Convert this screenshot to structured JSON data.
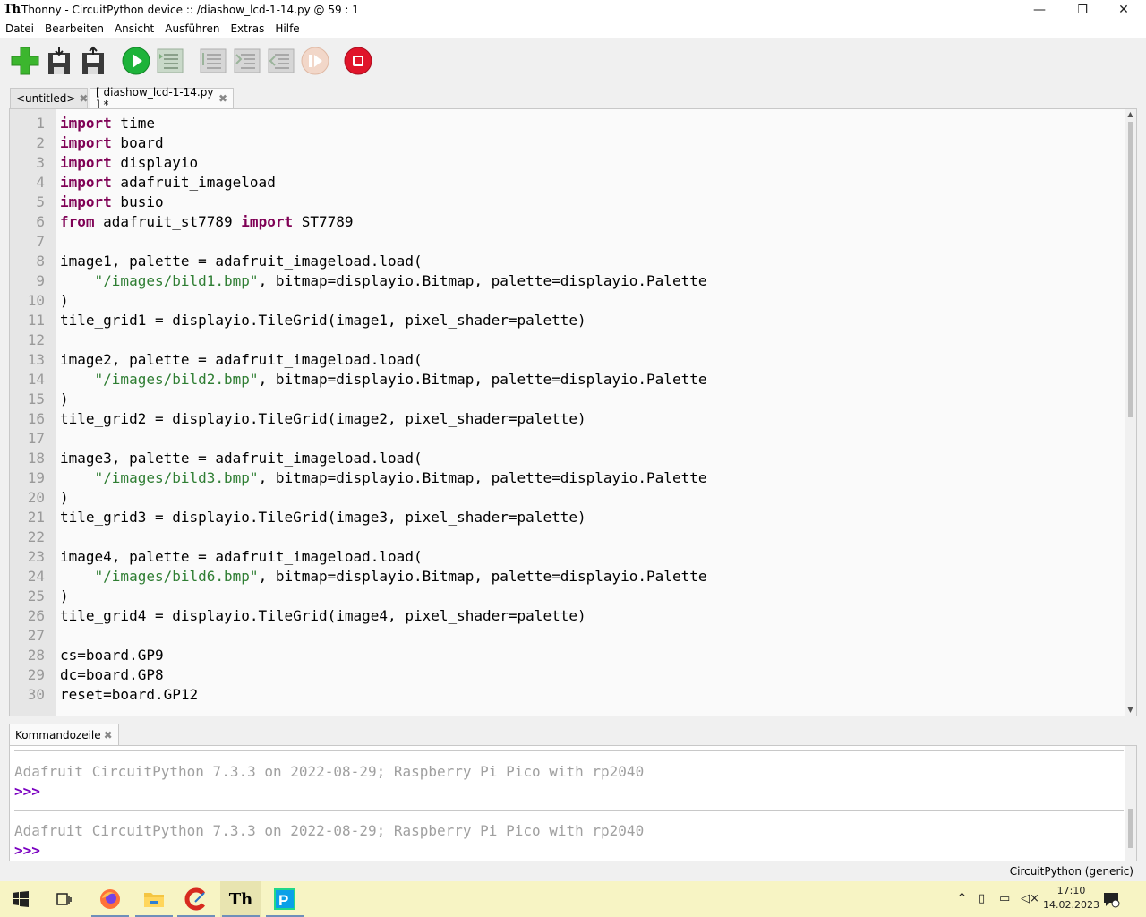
{
  "window": {
    "title": "Thonny  -  CircuitPython device :: /diashow_lcd-1-14.py  @  59 : 1",
    "controls": {
      "minimize": "—",
      "maximize": "❐",
      "close": "✕"
    }
  },
  "menu": [
    "Datei",
    "Bearbeiten",
    "Ansicht",
    "Ausführen",
    "Extras",
    "Hilfe"
  ],
  "toolbar": {
    "buttons": [
      "new-file",
      "load",
      "save",
      "run",
      "debug",
      "step-over",
      "step-into",
      "step-out",
      "resume",
      "stop"
    ]
  },
  "tabs": [
    {
      "label": "<untitled>",
      "close": "✖"
    },
    {
      "label": "[ diashow_lcd-1-14.py ] *",
      "close": "✖"
    }
  ],
  "editor": {
    "line_numbers": [
      "1",
      "2",
      "3",
      "4",
      "5",
      "6",
      "7",
      "8",
      "9",
      "10",
      "11",
      "12",
      "13",
      "14",
      "15",
      "16",
      "17",
      "18",
      "19",
      "20",
      "21",
      "22",
      "23",
      "24",
      "25",
      "26",
      "27",
      "28",
      "29",
      "30"
    ],
    "lines": [
      [
        {
          "t": "import",
          "k": "kw"
        },
        {
          "t": " time"
        }
      ],
      [
        {
          "t": "import",
          "k": "kw"
        },
        {
          "t": " board"
        }
      ],
      [
        {
          "t": "import",
          "k": "kw"
        },
        {
          "t": " displayio"
        }
      ],
      [
        {
          "t": "import",
          "k": "kw"
        },
        {
          "t": " adafruit_imageload"
        }
      ],
      [
        {
          "t": "import",
          "k": "kw"
        },
        {
          "t": " busio"
        }
      ],
      [
        {
          "t": "from",
          "k": "kw"
        },
        {
          "t": " adafruit_st7789 "
        },
        {
          "t": "import",
          "k": "kw"
        },
        {
          "t": " ST7789"
        }
      ],
      [
        {
          "t": ""
        }
      ],
      [
        {
          "t": "image1, palette = adafruit_imageload.load("
        }
      ],
      [
        {
          "t": "    "
        },
        {
          "t": "\"/images/bild1.bmp\"",
          "k": "str"
        },
        {
          "t": ", bitmap=displayio.Bitmap, palette=displayio.Palette"
        }
      ],
      [
        {
          "t": ")"
        }
      ],
      [
        {
          "t": "tile_grid1 = displayio.TileGrid(image1, pixel_shader=palette)"
        }
      ],
      [
        {
          "t": ""
        }
      ],
      [
        {
          "t": "image2, palette = adafruit_imageload.load("
        }
      ],
      [
        {
          "t": "    "
        },
        {
          "t": "\"/images/bild2.bmp\"",
          "k": "str"
        },
        {
          "t": ", bitmap=displayio.Bitmap, palette=displayio.Palette"
        }
      ],
      [
        {
          "t": ")"
        }
      ],
      [
        {
          "t": "tile_grid2 = displayio.TileGrid(image2, pixel_shader=palette)"
        }
      ],
      [
        {
          "t": ""
        }
      ],
      [
        {
          "t": "image3, palette = adafruit_imageload.load("
        }
      ],
      [
        {
          "t": "    "
        },
        {
          "t": "\"/images/bild3.bmp\"",
          "k": "str"
        },
        {
          "t": ", bitmap=displayio.Bitmap, palette=displayio.Palette"
        }
      ],
      [
        {
          "t": ")"
        }
      ],
      [
        {
          "t": "tile_grid3 = displayio.TileGrid(image3, pixel_shader=palette)"
        }
      ],
      [
        {
          "t": ""
        }
      ],
      [
        {
          "t": "image4, palette = adafruit_imageload.load("
        }
      ],
      [
        {
          "t": "    "
        },
        {
          "t": "\"/images/bild6.bmp\"",
          "k": "str"
        },
        {
          "t": ", bitmap=displayio.Bitmap, palette=displayio.Palette"
        }
      ],
      [
        {
          "t": ")"
        }
      ],
      [
        {
          "t": "tile_grid4 = displayio.TileGrid(image4, pixel_shader=palette)"
        }
      ],
      [
        {
          "t": ""
        }
      ],
      [
        {
          "t": "cs=board.GP9"
        }
      ],
      [
        {
          "t": "dc=board.GP8"
        }
      ],
      [
        {
          "t": "reset=board.GP12"
        }
      ]
    ]
  },
  "shell": {
    "tab_label": "Kommandozeile",
    "tab_close": "✖",
    "banner_1": "Adafruit CircuitPython 7.3.3 on 2022-08-29; Raspberry Pi Pico with rp2040",
    "prompt_1": ">>>",
    "banner_2": "Adafruit CircuitPython 7.3.3 on 2022-08-29; Raspberry Pi Pico with rp2040",
    "prompt_2": ">>>"
  },
  "status": {
    "interpreter": "CircuitPython (generic)"
  },
  "taskbar": {
    "apps": [
      "windows-start",
      "task-view",
      "firefox",
      "file-explorer",
      "ccleaner",
      "thonny",
      "pycharm"
    ],
    "clock_time": "17:10",
    "clock_date": "14.02.2023"
  },
  "colors": {
    "keyword": "#7f0055",
    "string": "#2e7d32",
    "prompt": "#7a00c0",
    "taskbar": "#f7f4c4"
  }
}
